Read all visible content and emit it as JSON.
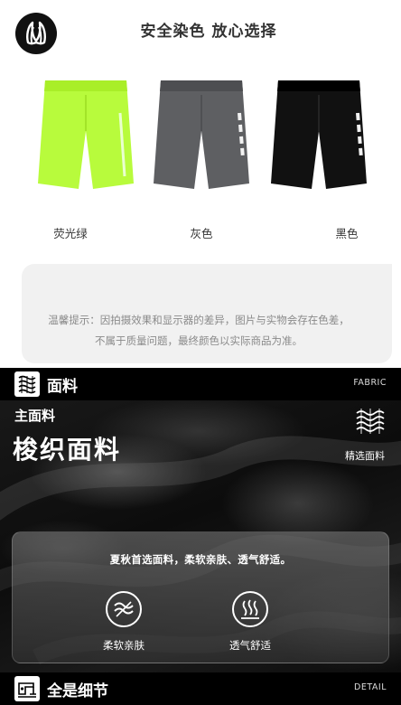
{
  "header": {
    "logo_icon": "lululemon-logo-icon",
    "headline": "安全染色 放心选择"
  },
  "products": [
    {
      "label": "荧光绿",
      "color": "#b8fb3c"
    },
    {
      "label": "灰色",
      "color": "#5e5f62"
    },
    {
      "label": "黑色",
      "color": "#111111"
    }
  ],
  "note": {
    "text": "温馨提示：因拍摄效果和显示器的差异，图片与实物会存在色差，不属于质量问题，最终颜色以实际商品为准。"
  },
  "fabric_bar": {
    "icon": "fabric-icon",
    "title": "面料",
    "en": "FABRIC"
  },
  "fabric": {
    "subtitle": "主面料",
    "title": "梭织面料",
    "select_icon": "fabric-wave-icon",
    "select_label": "精选面料",
    "description": "夏秋首选面料，柔软亲肤、透气舒适。",
    "features": [
      {
        "icon": "soft-skin-icon",
        "label": "柔软亲肤"
      },
      {
        "icon": "breathable-icon",
        "label": "透气舒适"
      }
    ]
  },
  "detail_bar": {
    "icon": "sewing-machine-icon",
    "title": "全是细节",
    "en": "DETAIL"
  }
}
